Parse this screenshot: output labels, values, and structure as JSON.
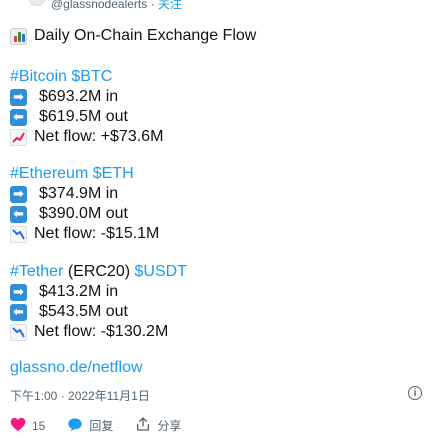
{
  "header": {
    "handle": "@glassnodealerts",
    "separator": " · ",
    "follow": "关注"
  },
  "tweet": {
    "title": "Daily On-Chain Exchange Flow",
    "sections": [
      {
        "hashtag": "#Bitcoin",
        "ticker": "$BTC",
        "inflow": "$693.2M in",
        "outflow": "$619.5M out",
        "net": "Net flow: +$73.6M",
        "trend": "up"
      },
      {
        "hashtag": "#Ethereum",
        "ticker": "$ETH",
        "inflow": "$374.9M in",
        "outflow": "$390.0M out",
        "net": "Net flow: -$15.1M",
        "trend": "down"
      },
      {
        "hashtag": "#Tether",
        "middle": " (ERC20) ",
        "ticker": "$USDT",
        "inflow": "$413.2M in",
        "outflow": "$543.5M out",
        "net": "Net flow: -$130.2M",
        "trend": "down"
      }
    ],
    "link": "glassno.de/netflow",
    "timestamp": "下午1:00 · 2022年11月1日"
  },
  "actions": {
    "likes": "15",
    "reply_label": "回复",
    "share_label": "分享"
  },
  "icons": {
    "chart": "bar-chart-icon",
    "inflow": "right-arrow-icon",
    "outflow": "left-arrow-icon",
    "trend_up": "chart-increasing-icon",
    "trend_down": "chart-decreasing-icon",
    "info": "info-icon",
    "like": "heart-icon",
    "reply": "speech-bubble-icon",
    "share": "share-icon"
  },
  "colors": {
    "link": "#1d9bf0",
    "like": "#f91880",
    "arrow_box": "#2f8fd6"
  }
}
